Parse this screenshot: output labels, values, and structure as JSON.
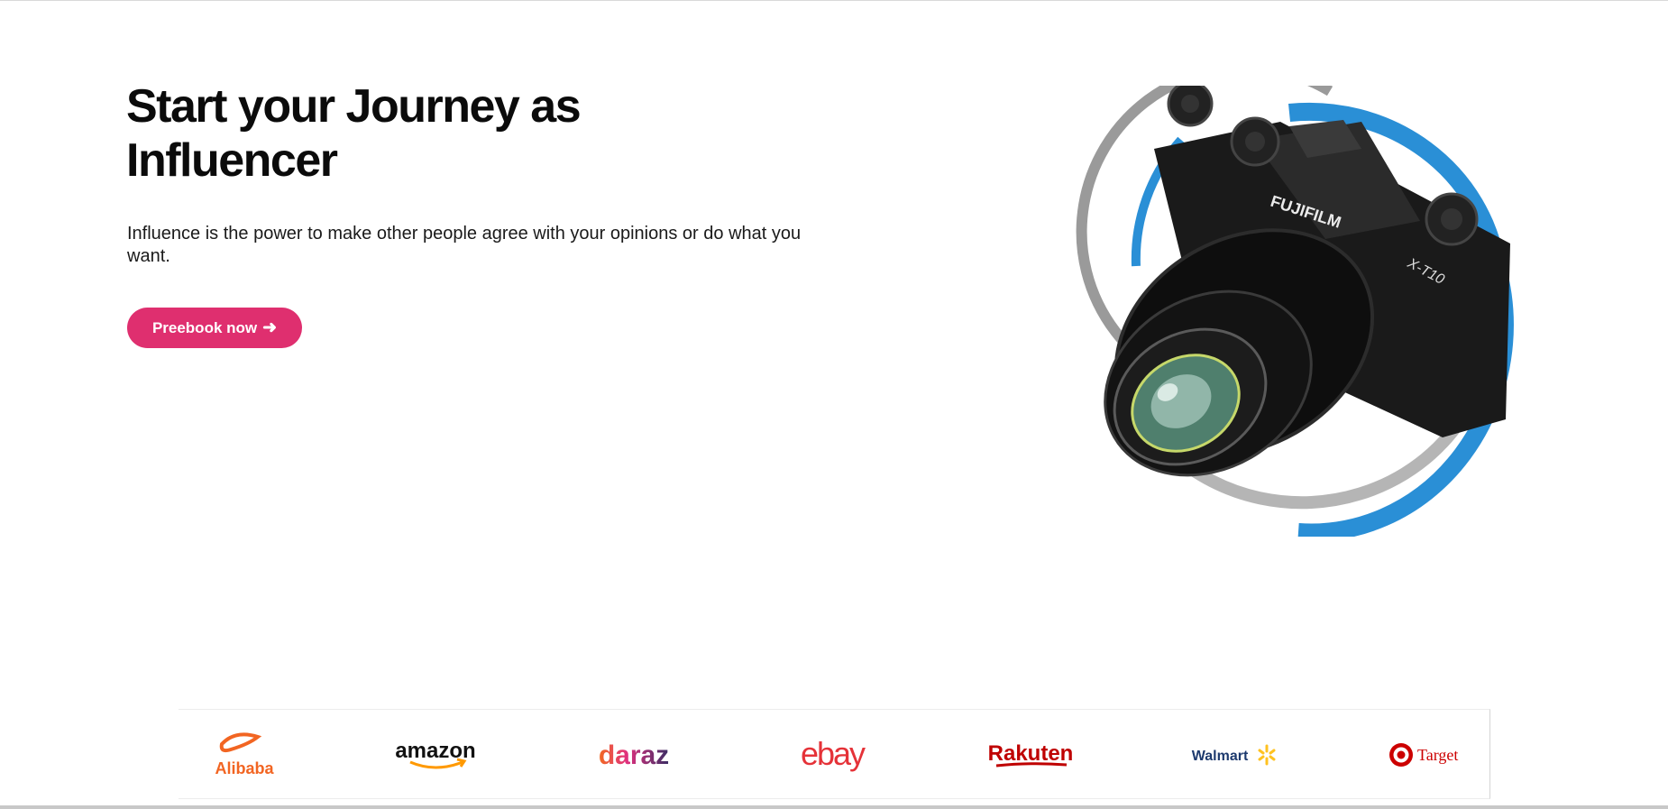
{
  "hero": {
    "title": "Start your Journey as Influencer",
    "subtitle": "Influence is the power to make other people agree with your opinions or do what you want.",
    "cta_label": "Preebook now",
    "cta_icon": "arrow-right-icon",
    "image": {
      "subject": "camera",
      "brand_text": "FUJIFILM",
      "model_text": "X-T10"
    }
  },
  "brands": {
    "items": [
      {
        "name": "Alibaba",
        "icon": "alibaba-logo"
      },
      {
        "name": "amazon",
        "icon": "amazon-logo"
      },
      {
        "name": "daraz",
        "icon": "daraz-logo"
      },
      {
        "name": "ebay",
        "icon": "ebay-logo"
      },
      {
        "name": "Rakuten",
        "icon": "rakuten-logo"
      },
      {
        "name": "Walmart",
        "icon": "walmart-logo"
      },
      {
        "name": "Target",
        "icon": "target-logo"
      }
    ]
  },
  "colors": {
    "accent": "#df2f6f",
    "text": "#0b0b0b",
    "ring_blue": "#2a8fd6",
    "ring_gray": "#9a9a9a"
  }
}
